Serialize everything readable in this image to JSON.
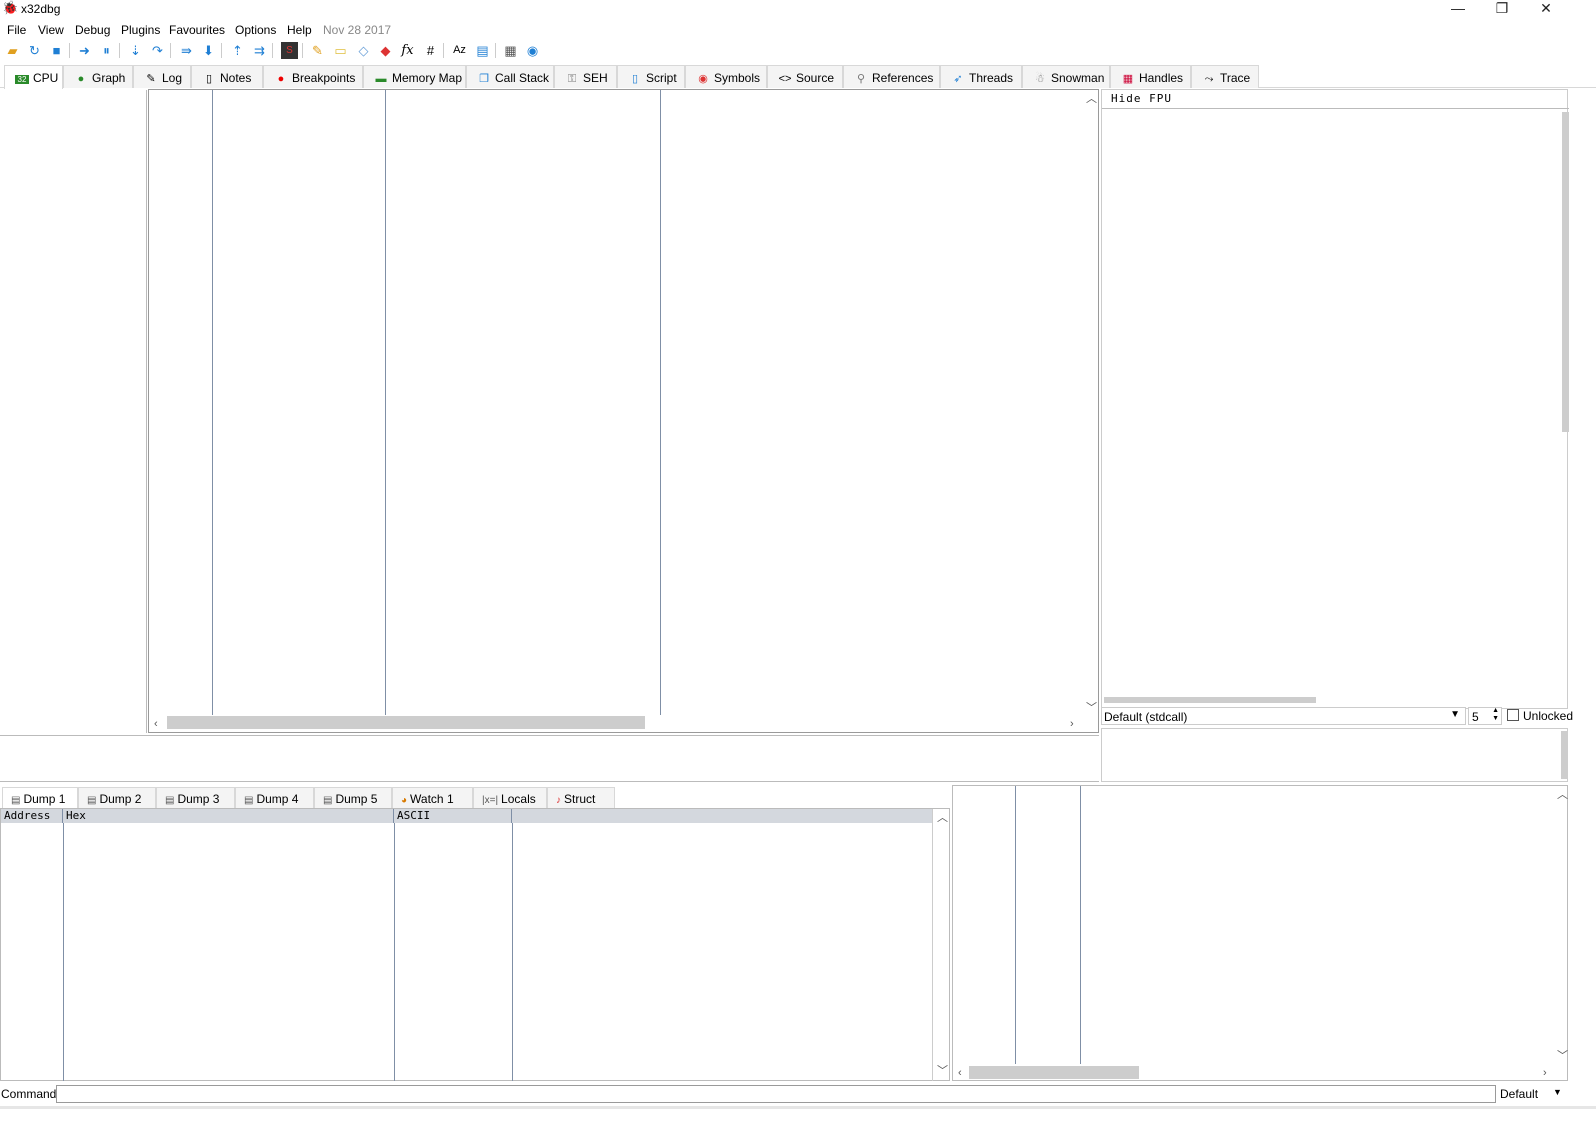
{
  "window": {
    "title": "x32dbg",
    "minimize": "—",
    "maximize": "❐",
    "close": "✕"
  },
  "menu": {
    "items": [
      "File",
      "View",
      "Debug",
      "Plugins",
      "Favourites",
      "Options",
      "Help"
    ],
    "date": "Nov 28 2017"
  },
  "toolbar": {
    "icons": [
      "open-icon",
      "restart-icon",
      "close-icon",
      "run-icon",
      "pause-icon",
      "step-into-icon",
      "step-over-icon",
      "trace-into-icon",
      "trace-over-icon",
      "execute-till-return-icon",
      "run-to-user-code-icon",
      "scylla-icon",
      "patch-icon",
      "comment-icon",
      "label-icon",
      "bookmark-icon",
      "function-icon",
      "hash-icon",
      "strings-icon",
      "calls-icon",
      "calculator-icon",
      "website-icon"
    ]
  },
  "tabs": [
    {
      "label": "CPU",
      "icon": "cpu-icon",
      "active": true
    },
    {
      "label": "Graph",
      "icon": "graph-icon"
    },
    {
      "label": "Log",
      "icon": "log-icon"
    },
    {
      "label": "Notes",
      "icon": "notes-icon"
    },
    {
      "label": "Breakpoints",
      "icon": "breakpoint-icon"
    },
    {
      "label": "Memory Map",
      "icon": "memory-icon"
    },
    {
      "label": "Call Stack",
      "icon": "callstack-icon"
    },
    {
      "label": "SEH",
      "icon": "seh-icon"
    },
    {
      "label": "Script",
      "icon": "script-icon"
    },
    {
      "label": "Symbols",
      "icon": "symbols-icon"
    },
    {
      "label": "Source",
      "icon": "source-icon"
    },
    {
      "label": "References",
      "icon": "references-icon"
    },
    {
      "label": "Threads",
      "icon": "threads-icon"
    },
    {
      "label": "Snowman",
      "icon": "snowman-icon"
    },
    {
      "label": "Handles",
      "icon": "handles-icon"
    },
    {
      "label": "Trace",
      "icon": "trace-icon"
    }
  ],
  "registers": {
    "hide_fpu": "Hide FPU",
    "calling_convention": "Default (stdcall)",
    "arg_count": "5",
    "unlocked_label": "Unlocked"
  },
  "dump_tabs": [
    {
      "label": "Dump 1",
      "active": true
    },
    {
      "label": "Dump 2"
    },
    {
      "label": "Dump 3"
    },
    {
      "label": "Dump 4"
    },
    {
      "label": "Dump 5"
    },
    {
      "label": "Watch 1"
    },
    {
      "label": "Locals"
    },
    {
      "label": "Struct"
    }
  ],
  "dump_columns": {
    "address": "Address",
    "hex": "Hex",
    "ascii": "ASCII"
  },
  "command": {
    "label": "Command:",
    "value": "",
    "mode": "Default"
  },
  "colors": {
    "column_line": "#7f8fa6",
    "header_bg": "#d4d8de",
    "scroll_thumb": "#cdcdcd"
  }
}
